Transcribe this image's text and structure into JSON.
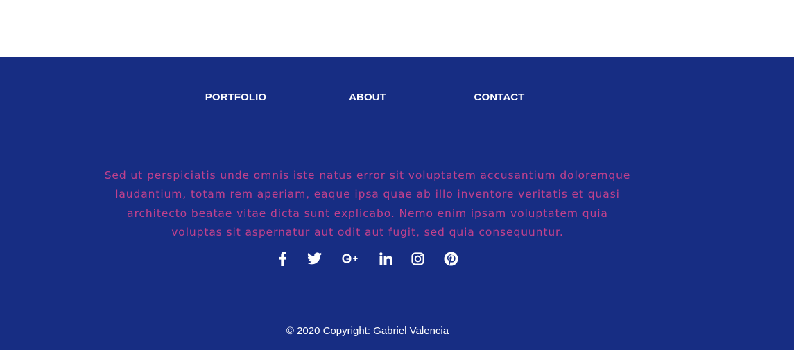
{
  "nav": {
    "items": [
      {
        "label": "PORTFOLIO"
      },
      {
        "label": "ABOUT"
      },
      {
        "label": "CONTACT"
      }
    ]
  },
  "footer": {
    "description": "Sed ut perspiciatis unde omnis iste natus error sit voluptatem accusantium doloremque laudantium, totam rem aperiam, eaque ipsa quae ab illo inventore veritatis et quasi architecto beatae vitae dicta sunt explicabo. Nemo enim ipsam voluptatem quia voluptas sit aspernatur aut odit aut fugit, sed quia consequuntur.",
    "social_icons": [
      "facebook-icon",
      "twitter-icon",
      "google-plus-icon",
      "linkedin-icon",
      "instagram-icon",
      "pinterest-icon"
    ],
    "copyright": "© 2020 Copyright: Gabriel Valencia"
  },
  "colors": {
    "footer_background": "#172d83",
    "description_text": "#c2418d",
    "nav_text": "#ffffff"
  }
}
